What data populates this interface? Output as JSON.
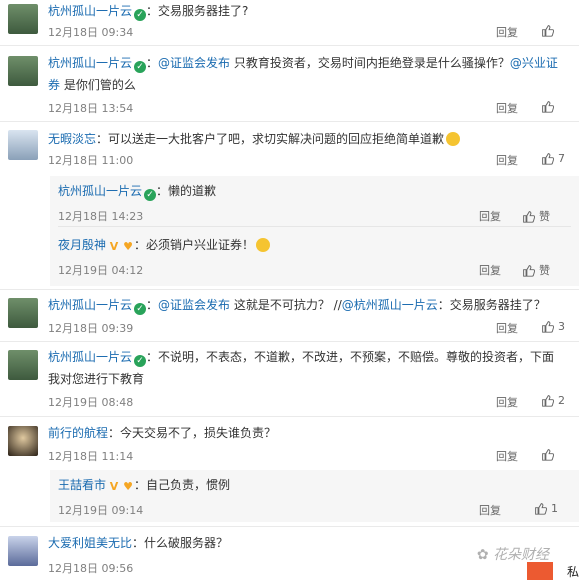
{
  "actions": {
    "reply": "回复",
    "like_label": "赞"
  },
  "comments": [
    {
      "name": "杭州孤山一片云",
      "sep": "：",
      "text": "交易服务器挂了?",
      "time": "12月18日 09:34"
    },
    {
      "name": "杭州孤山一片云",
      "sep": "：",
      "at1": "@证监会发布",
      "text1": " 只教育投资者，交易时间内拒绝登录是什么骚操作？",
      "at2": "@兴业证",
      "at2b": "券",
      "text2": " 是你们管的么",
      "time": "12月18日 13:54"
    },
    {
      "name": "无暇淡忘",
      "sep": "：",
      "text": "可以送走一大批客户了吧，求切实解决问题的回应拒绝简单道歉",
      "time": "12月18日 11:00",
      "likes": "7"
    },
    {
      "name": "杭州孤山一片云",
      "sep": "：",
      "text": "懒的道歉",
      "time": "12月18日 14:23"
    },
    {
      "name": "夜月殷神",
      "sep": "：",
      "text": "必须销户兴业证券！",
      "time": "12月19日 04:12"
    },
    {
      "name": "杭州孤山一片云",
      "sep": "：",
      "at1": "@证监会发布",
      "text1": " 这就是不可抗力？ //",
      "at2": "@杭州孤山一片云",
      "text2": "：交易服务器挂了？",
      "time": "12月18日 09:39",
      "likes": "3"
    },
    {
      "name": "杭州孤山一片云",
      "sep": "：",
      "text": "不说明，不表态，不道歉，不改进，不预案，不赔偿。尊敬的投资者，下面",
      "text2": "我对您进行下教育",
      "time": "12月19日 08:48",
      "likes": "2"
    },
    {
      "name": "前行的航程",
      "sep": "：",
      "text": "今天交易不了，损失谁负责？",
      "time": "12月18日 11:14"
    },
    {
      "name": "王喆看市",
      "sep": "：",
      "text": "自己负责，惯例",
      "time": "12月19日 09:14",
      "likes": "1"
    },
    {
      "name": "大爱利姐美无比",
      "sep": "：",
      "text": "什么破服务器？",
      "time": "12月18日 09:56"
    }
  ],
  "watermark": "花朵财经",
  "corner_text": "私"
}
